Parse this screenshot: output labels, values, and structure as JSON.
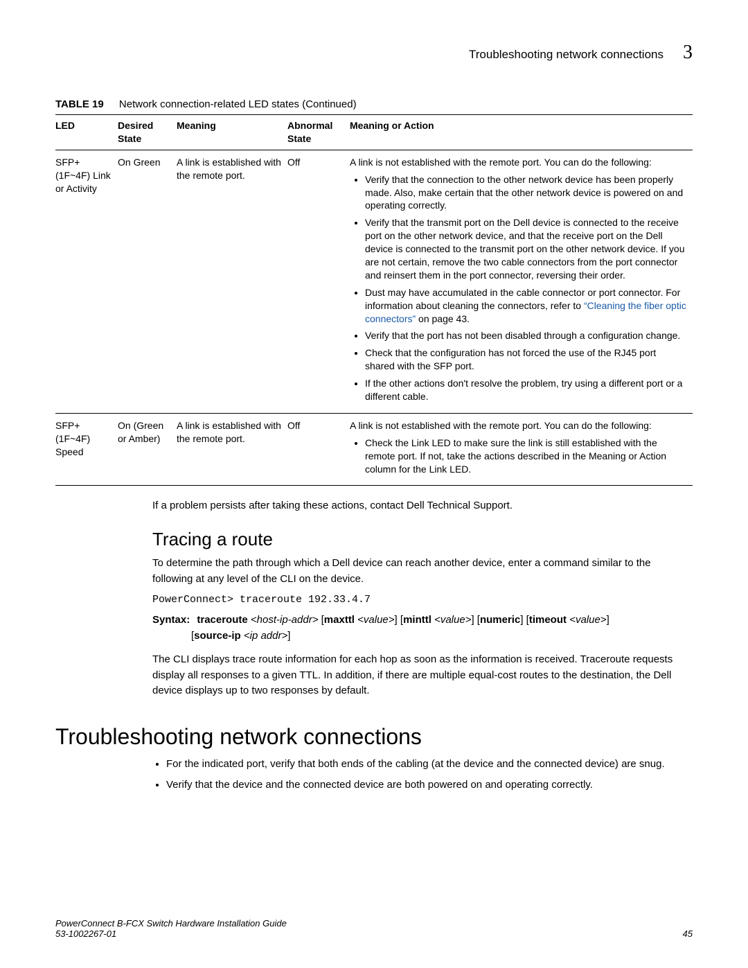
{
  "header": {
    "title": "Troubleshooting network connections",
    "chapter_number": "3"
  },
  "table": {
    "label": "TABLE 19",
    "caption": "Network connection-related LED states (Continued)",
    "headers": {
      "led": "LED",
      "desired": "Desired State",
      "meaning": "Meaning",
      "abnormal": "Abnormal State",
      "action": "Meaning or Action"
    },
    "rows": [
      {
        "led": "SFP+ (1F~4F) Link or Activity",
        "desired": "On Green",
        "meaning": "A link is established with the remote port.",
        "abnormal": "Off",
        "action_intro": "A link is not established with the remote port. You can do the following:",
        "bullets": [
          {
            "text": "Verify that the connection to the other network device has been properly made. Also, make certain that the other network device is powered on and operating correctly."
          },
          {
            "text": "Verify that the transmit port on the Dell device is connected to the receive port on the other network device, and that the receive port on the Dell device is connected to the transmit port on the other network device. If you are not certain, remove the two cable connectors from the port connector and reinsert them in the port connector, reversing their order."
          },
          {
            "text_pre": "Dust may have accumulated in the cable connector or port connector. For information about cleaning the connectors, refer to ",
            "link": "“Cleaning the fiber optic connectors”",
            "text_post": " on page 43."
          },
          {
            "text": "Verify that the port has not been disabled through a configuration change."
          },
          {
            "text": "Check that the configuration has not forced the use of the RJ45 port shared with the SFP port."
          },
          {
            "text": "If the other actions don't resolve the problem, try using a different port or a different cable."
          }
        ]
      },
      {
        "led": "SFP+ (1F~4F) Speed",
        "desired": "On (Green or Amber)",
        "meaning": "A link is established with the remote port.",
        "abnormal": "Off",
        "action_intro": "A link is not established with the remote port. You can do the following:",
        "bullets": [
          {
            "text": "Check the Link LED to make sure the link is still established with the remote port. If not, take the actions described in the Meaning or Action column for the Link LED."
          }
        ]
      }
    ]
  },
  "after_table_note": "If a problem persists after taking these actions, contact Dell Technical Support.",
  "tracing": {
    "heading": "Tracing a route",
    "intro": "To determine the path through which a Dell device can reach another device, enter a command similar to the following at any level of the CLI on the device.",
    "code": "PowerConnect> traceroute 192.33.4.7",
    "syntax": {
      "label": "Syntax:",
      "cmd": "traceroute",
      "host": "<host-ip-addr>",
      "maxttl_kw": "maxttl",
      "value1": "<value>",
      "minttl_kw": "minttl",
      "value2": "<value>",
      "numeric_kw": "numeric",
      "timeout_kw": "timeout",
      "value3": "<value>",
      "sourceip_kw": "source-ip",
      "ipaddr": "<ip addr>"
    },
    "after": "The CLI displays trace route information for each hop as soon as the information is received. Traceroute requests display all responses to a given TTL. In addition, if there are multiple equal-cost routes to the destination, the Dell device displays up to two responses by default."
  },
  "troubleshoot": {
    "heading": "Troubleshooting network connections",
    "bullets": [
      "For the indicated port, verify that both ends of the cabling (at the device and the connected device) are snug.",
      "Verify that the device and the connected device are both powered on and operating correctly."
    ]
  },
  "footer": {
    "line1": "PowerConnect B-FCX Switch Hardware Installation Guide",
    "line2": "53-1002267-01",
    "page": "45"
  }
}
